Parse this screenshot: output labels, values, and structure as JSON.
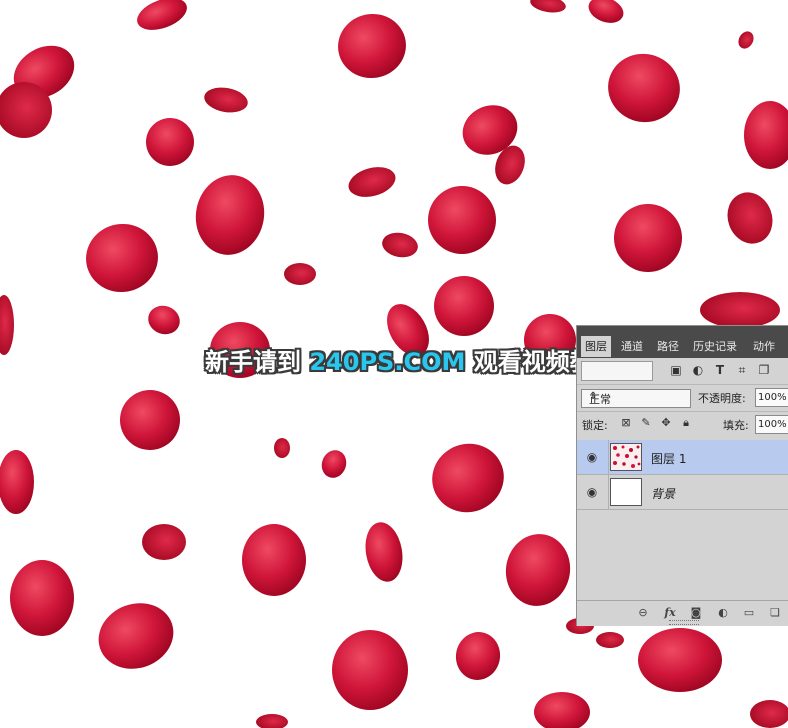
{
  "watermark": {
    "prefix": "新手请到",
    "site": "240PS.COM",
    "suffix": "观看视频教程"
  },
  "panel": {
    "tabs": [
      {
        "label": "图层",
        "active": true
      },
      {
        "label": "通道",
        "active": false
      },
      {
        "label": "路径",
        "active": false
      },
      {
        "label": "历史记录",
        "active": false
      },
      {
        "label": "动作",
        "active": false
      }
    ],
    "blend_mode": "正常",
    "opacity_label": "不透明度:",
    "opacity_value": "100%",
    "lock_label": "锁定:",
    "fill_label": "填充:",
    "fill_value": "100%",
    "layers": [
      {
        "name": "图层 1",
        "selected": true,
        "visible": true
      },
      {
        "name": "背景",
        "selected": false,
        "visible": true
      }
    ],
    "footer_icons": [
      "link-icon",
      "fx-icon",
      "mask-icon",
      "adjustment-icon",
      "folder-icon",
      "new-layer-icon"
    ]
  },
  "colors": {
    "petal_dark": "#a5051f",
    "petal_mid": "#d11636",
    "petal_light": "#ea3a55",
    "panel_bg": "#d3d3d3",
    "tab_bar": "#4a4a4a",
    "selected_layer": "#b8cbee",
    "watermark_site": "#29c6ee"
  }
}
